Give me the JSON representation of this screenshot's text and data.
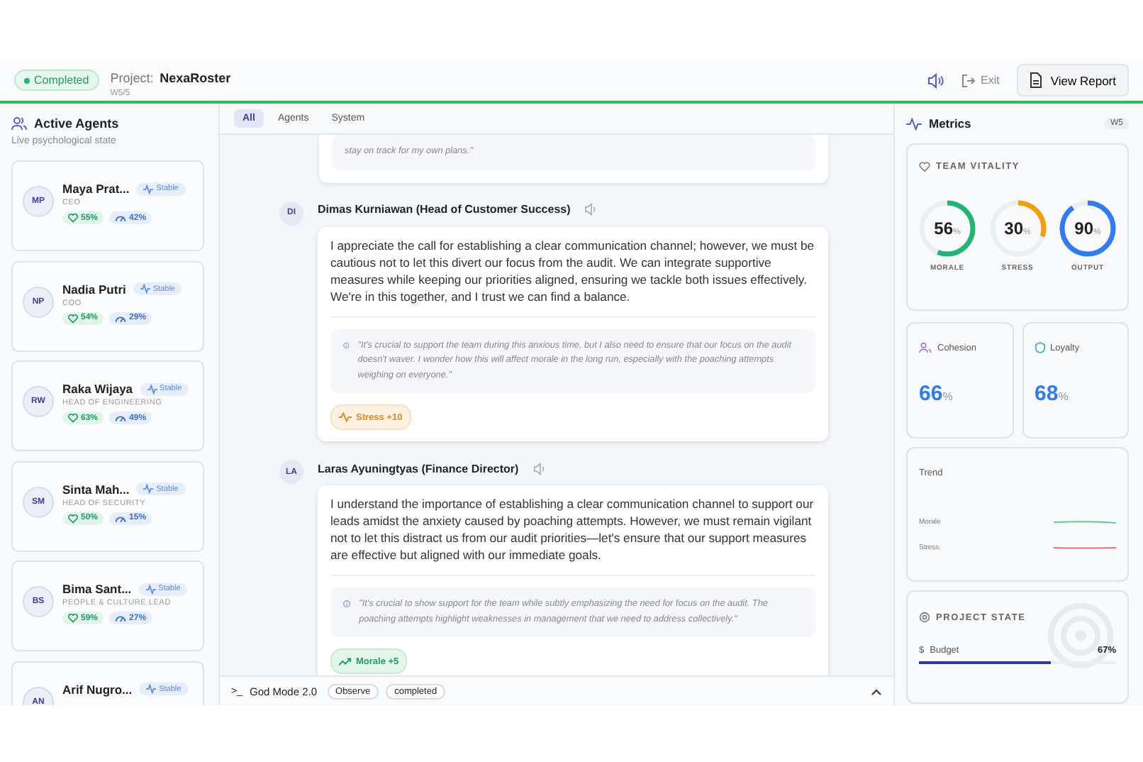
{
  "header": {
    "status": "Completed",
    "project_label": "Project:",
    "project_name": "NexaRoster",
    "week": "W5/5",
    "exit": "Exit",
    "view_report": "View Report"
  },
  "agents_panel": {
    "title": "Active Agents",
    "subtitle": "Live psychological state",
    "agents": [
      {
        "initials": "MP",
        "name": "Maya Prat...",
        "role": "CEO",
        "status": "Stable",
        "morale": "55%",
        "stress": "42%"
      },
      {
        "initials": "NP",
        "name": "Nadia Putri",
        "role": "COO",
        "status": "Stable",
        "morale": "54%",
        "stress": "29%"
      },
      {
        "initials": "RW",
        "name": "Raka Wijaya",
        "role": "HEAD OF ENGINEERING",
        "status": "Stable",
        "morale": "63%",
        "stress": "49%"
      },
      {
        "initials": "SM",
        "name": "Sinta Mah...",
        "role": "HEAD OF SECURITY",
        "status": "Stable",
        "morale": "50%",
        "stress": "15%"
      },
      {
        "initials": "BS",
        "name": "Bima Sant...",
        "role": "PEOPLE & CULTURE LEAD",
        "status": "Stable",
        "morale": "59%",
        "stress": "27%"
      },
      {
        "initials": "AN",
        "name": "Arif Nugro...",
        "status": "Stable"
      }
    ]
  },
  "feed": {
    "tabs": [
      {
        "label": "All",
        "selected": true
      },
      {
        "label": "Agents",
        "selected": false
      },
      {
        "label": "System",
        "selected": false
      }
    ],
    "partial_thought": "stay on track for my own plans.\"",
    "messages": [
      {
        "initials": "DI",
        "speaker": "Dimas Kurniawan (Head of Customer Success)",
        "text": "I appreciate the call for establishing a clear communication channel; however, we must be cautious not to let this divert our focus from the audit. We can integrate supportive measures while keeping our priorities aligned, ensuring we tackle both issues effectively. We're in this together, and I trust we can find a balance.",
        "thought": "\"It's crucial to support the team during this anxious time, but I also need to ensure that our focus on the audit doesn't waver. I wonder how this will affect morale in the long run, especially with the poaching attempts weighing on everyone.\"",
        "effect": {
          "kind": "stress",
          "label": "Stress +10"
        }
      },
      {
        "initials": "LA",
        "speaker": "Laras Ayuningtyas (Finance Director)",
        "text": "I understand the importance of establishing a clear communication channel to support our leads amidst the anxiety caused by poaching attempts. However, we must remain vigilant not to let this distract us from our audit priorities—let's ensure that our support measures are effective but aligned with our immediate goals.",
        "thought": "\"It's crucial to show support for the team while subtly emphasizing the need for focus on the audit. The poaching attempts highlight weaknesses in management that we need to address collectively.\"",
        "effect": {
          "kind": "morale",
          "label": "Morale +5"
        }
      }
    ],
    "console": {
      "prompt": ">_",
      "title": "God Mode 2.0",
      "chips": [
        "Observe",
        "completed"
      ]
    }
  },
  "metrics": {
    "title": "Metrics",
    "week": "W5",
    "vitality": {
      "title": "TEAM VITALITY",
      "gauges": [
        {
          "value": "56",
          "unit": "%",
          "label": "MORALE",
          "level": 0.56,
          "color": "#22b573"
        },
        {
          "value": "30",
          "unit": "%",
          "label": "STRESS",
          "level": 0.3,
          "color": "#f59e0b"
        },
        {
          "value": "90",
          "unit": "%",
          "label": "OUTPUT",
          "level": 0.9,
          "color": "#2f7cf6"
        }
      ]
    },
    "stats": [
      {
        "kind": "cohesion",
        "label": "Cohesion",
        "value": "66",
        "unit": "%"
      },
      {
        "kind": "loyalty",
        "label": "Loyalty",
        "value": "68",
        "unit": "%"
      }
    ],
    "trend": {
      "title": "Trend",
      "lines": [
        {
          "label": "Morale",
          "color": "#5ccf8f"
        },
        {
          "label": "Stress",
          "color": "#e57373"
        }
      ]
    },
    "project_state": {
      "title": "PROJECT STATE",
      "items": [
        {
          "symbol": "$",
          "label": "Budget",
          "value": "67%",
          "level": 0.67
        }
      ]
    }
  }
}
